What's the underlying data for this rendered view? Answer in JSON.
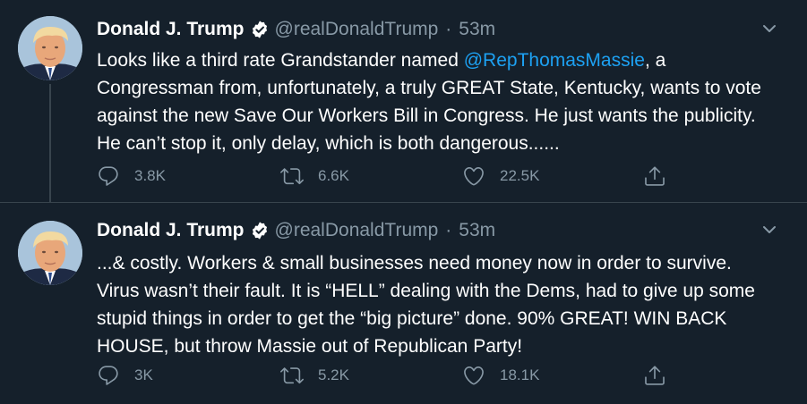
{
  "tweets": [
    {
      "author_name": "Donald J. Trump",
      "handle": "@realDonaldTrump",
      "separator": "·",
      "time": "53m",
      "text_before_mention": "Looks like a third rate Grandstander named ",
      "mention": "@RepThomasMassie",
      "text_after_mention": ", a Congressman from, unfortunately, a truly GREAT State, Kentucky, wants to vote against the new Save Our Workers Bill in Congress. He just wants the publicity. He can’t stop it, only delay, which is both dangerous......",
      "replies": "3.8K",
      "retweets": "6.6K",
      "likes": "22.5K"
    },
    {
      "author_name": "Donald J. Trump",
      "handle": "@realDonaldTrump",
      "separator": "·",
      "time": "53m",
      "text": "...& costly. Workers & small businesses need money now in order to survive. Virus wasn’t their fault. It is “HELL” dealing with the Dems, had to give up some stupid things in order to get the “big picture” done. 90% GREAT! WIN BACK HOUSE, but throw Massie out of Republican Party!",
      "replies": "3K",
      "retweets": "5.2K",
      "likes": "18.1K"
    }
  ],
  "icons": {
    "verified": "verified-badge-icon",
    "caret": "chevron-down-icon",
    "reply": "reply-icon",
    "retweet": "retweet-icon",
    "like": "heart-icon",
    "share": "share-icon"
  },
  "colors": {
    "background": "#15202b",
    "text": "#ffffff",
    "secondary": "#8899a6",
    "link": "#1da1f2",
    "divider": "#38444d"
  }
}
